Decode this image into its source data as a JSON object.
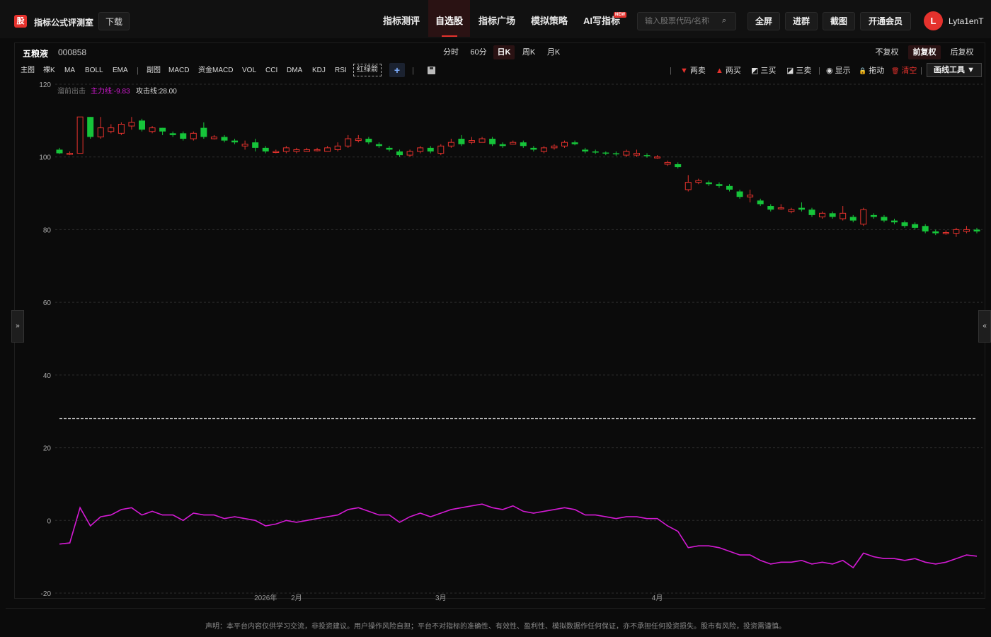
{
  "brand": {
    "logo_char": "股",
    "title": "指标公式评测室",
    "download": "下载"
  },
  "nav": [
    {
      "label": "指标测评",
      "active": false
    },
    {
      "label": "自选股",
      "active": true
    },
    {
      "label": "指标广场",
      "active": false
    },
    {
      "label": "模拟策略",
      "active": false
    },
    {
      "label": "AI写指标",
      "active": false,
      "badge": "NEW"
    }
  ],
  "search": {
    "placeholder": "输入股票代码/名称",
    "icon": "search-icon"
  },
  "top_buttons": [
    "全屏",
    "进群",
    "截图",
    "开通会员"
  ],
  "user": {
    "initial": "L",
    "name": "Lyta1enT"
  },
  "stock": {
    "name": "五粮液",
    "code": "000858"
  },
  "periods": [
    {
      "label": "分时",
      "active": false
    },
    {
      "label": "60分",
      "active": false
    },
    {
      "label": "日K",
      "active": true
    },
    {
      "label": "周K",
      "active": false
    },
    {
      "label": "月K",
      "active": false
    }
  ],
  "rights": [
    {
      "label": "不复权",
      "active": false
    },
    {
      "label": "前复权",
      "active": true
    },
    {
      "label": "后复权",
      "active": false
    }
  ],
  "indicators_main": [
    "主图",
    "裸K",
    "MA",
    "BOLL",
    "EMA"
  ],
  "indicators_sub": [
    "副图",
    "MACD",
    "资金MACD",
    "VOL",
    "CCI",
    "DMA",
    "KDJ",
    "RSI"
  ],
  "redline_label": "红绿箭",
  "plus_label": "+",
  "draw_buttons": [
    {
      "icon": "▼",
      "label": "两卖",
      "color": "#e5322d"
    },
    {
      "icon": "▲",
      "label": "两买",
      "color": "#e5322d"
    },
    {
      "icon": "◩",
      "label": "三买",
      "color": "#dddddd"
    },
    {
      "icon": "◪",
      "label": "三卖",
      "color": "#dddddd"
    },
    {
      "icon": "◉",
      "label": "显示",
      "color": "#dddddd"
    },
    {
      "icon": "🔒",
      "label": "拖动",
      "color": "#dddddd"
    },
    {
      "icon": "🗑",
      "label": "清空",
      "color": "#e5322d"
    }
  ],
  "draw_tool": "画线工具 ▼",
  "side_left": "»",
  "side_right": "«",
  "legend": [
    {
      "label": "溜前出击",
      "color": "#777777"
    },
    {
      "label": "主力线:-9.83",
      "color": "#d41ad4"
    },
    {
      "label": "攻击线:28.00",
      "color": "#dddddd"
    }
  ],
  "disclaimer": "声明：本平台内容仅供学习交流，非投资建议。用户操作风险自担；平台不对指标的准确性、有效性、盈利性、模拟数据作任何保证，亦不承担任何投资损失。股市有风险，投资需谨慎。",
  "chart_data": {
    "type": "candlestick",
    "y_ticks": [
      120,
      100,
      80,
      60,
      40,
      20,
      0,
      -20
    ],
    "ylim": [
      -20,
      120
    ],
    "x_labels": [
      "2026年",
      "2月",
      "3月",
      "4月"
    ],
    "x_label_at": [
      20,
      23,
      37,
      58
    ],
    "attack_line": 28,
    "colors": {
      "up": "#e5322d",
      "down": "#16c43a",
      "main_line": "#d41ad4"
    },
    "candles": [
      [
        102,
        101,
        102.5,
        100.8
      ],
      [
        101,
        101,
        101.5,
        100.5
      ],
      [
        101,
        111,
        111,
        101
      ],
      [
        111,
        105.5,
        111,
        105
      ],
      [
        105.5,
        108,
        111,
        105
      ],
      [
        107,
        108,
        109,
        106.5
      ],
      [
        106.5,
        109,
        109.5,
        106
      ],
      [
        108.5,
        109.5,
        111,
        107.5
      ],
      [
        110,
        107.5,
        110.5,
        107
      ],
      [
        107,
        108,
        108.5,
        106.5
      ],
      [
        108,
        107,
        108,
        106
      ],
      [
        106.5,
        106,
        107,
        105.5
      ],
      [
        106.5,
        105,
        107,
        104.5
      ],
      [
        105,
        106.5,
        107,
        104.5
      ],
      [
        108,
        105.5,
        109.5,
        105
      ],
      [
        105,
        105.5,
        106,
        104.8
      ],
      [
        105.5,
        104.5,
        106,
        104
      ],
      [
        104.5,
        104,
        105,
        103.5
      ],
      [
        103,
        103.5,
        104.5,
        102
      ],
      [
        104,
        102.5,
        105,
        101.5
      ],
      [
        102.5,
        101.5,
        103,
        101
      ],
      [
        101.5,
        101.5,
        102,
        101
      ],
      [
        101.5,
        102.5,
        103,
        101
      ],
      [
        101.5,
        102,
        102.5,
        101
      ],
      [
        101.5,
        102,
        102.5,
        101.5
      ],
      [
        102,
        102,
        102.5,
        101.5
      ],
      [
        101.5,
        102.5,
        103,
        101.5
      ],
      [
        102,
        103,
        104,
        101.5
      ],
      [
        103,
        105,
        106,
        102.5
      ],
      [
        104.5,
        105,
        106,
        104
      ],
      [
        105,
        104,
        105.5,
        103.5
      ],
      [
        103.5,
        103,
        104,
        102.5
      ],
      [
        102.5,
        102,
        103,
        101.5
      ],
      [
        101.5,
        100.5,
        102,
        100
      ],
      [
        100.5,
        101.5,
        102,
        100
      ],
      [
        101.5,
        102.5,
        103,
        101
      ],
      [
        102.5,
        101.5,
        103,
        101
      ],
      [
        101,
        103,
        103.5,
        100.5
      ],
      [
        103,
        104,
        105,
        102.5
      ],
      [
        105,
        103.5,
        106,
        103
      ],
      [
        104,
        104.5,
        105.5,
        103.5
      ],
      [
        104,
        105,
        105.5,
        104
      ],
      [
        105,
        103.5,
        105.5,
        103
      ],
      [
        103.5,
        103,
        104,
        102.5
      ],
      [
        103.5,
        104,
        104.5,
        103.5
      ],
      [
        104,
        103,
        104.5,
        102.5
      ],
      [
        102.5,
        102,
        103,
        101.5
      ],
      [
        101.5,
        102.5,
        103,
        101
      ],
      [
        102.5,
        103,
        103.5,
        102
      ],
      [
        103,
        104,
        104.5,
        102.5
      ],
      [
        104,
        103.5,
        104.5,
        103.2
      ],
      [
        102,
        101.5,
        102.5,
        101
      ],
      [
        101.5,
        101.2,
        102,
        100.8
      ],
      [
        101.2,
        101,
        101.5,
        100.5
      ],
      [
        101,
        100.8,
        101.5,
        100.3
      ],
      [
        100.5,
        101.5,
        102,
        100
      ],
      [
        100.5,
        101,
        102,
        100
      ],
      [
        100.5,
        100.2,
        101,
        99.8
      ],
      [
        100,
        100,
        100.5,
        99.5
      ],
      [
        98,
        98.5,
        99,
        97.5
      ],
      [
        98,
        97.2,
        98.5,
        96.8
      ],
      [
        91,
        93,
        95,
        90.5
      ],
      [
        93,
        93.5,
        94,
        92.5
      ],
      [
        93,
        92.5,
        93.5,
        92
      ],
      [
        92.5,
        92,
        93,
        91.5
      ],
      [
        92,
        91,
        92.5,
        90.5
      ],
      [
        90.5,
        89,
        91,
        88.5
      ],
      [
        89,
        89.5,
        91,
        87.5
      ],
      [
        88,
        87,
        88.5,
        86.5
      ],
      [
        86.5,
        85.5,
        87,
        85
      ],
      [
        86,
        86,
        87,
        85.5
      ],
      [
        85,
        85.5,
        86,
        84.5
      ],
      [
        86,
        85.5,
        87.5,
        85
      ],
      [
        85.5,
        84,
        86,
        83.5
      ],
      [
        83.5,
        84.5,
        85,
        83
      ],
      [
        84.5,
        83.5,
        85,
        83
      ],
      [
        83,
        84.5,
        86.5,
        82.5
      ],
      [
        83.5,
        82.5,
        84,
        82
      ],
      [
        81.5,
        85.5,
        86,
        81
      ],
      [
        84,
        83.5,
        84.5,
        83
      ],
      [
        83.5,
        82.5,
        84,
        82
      ],
      [
        82.5,
        82,
        83,
        81.5
      ],
      [
        82,
        81,
        82.5,
        80.5
      ],
      [
        81.5,
        80.5,
        82,
        80
      ],
      [
        81,
        79.5,
        81.5,
        79
      ],
      [
        79.5,
        79,
        80,
        78.5
      ],
      [
        79,
        79.2,
        79.8,
        78.6
      ],
      [
        79,
        80,
        80.5,
        78
      ],
      [
        79.5,
        80,
        81,
        79
      ],
      [
        80,
        79.5,
        80.5,
        79
      ]
    ],
    "main_line": [
      -6.5,
      -6.2,
      3.5,
      -1.5,
      1,
      1.5,
      3,
      3.5,
      1.5,
      2.5,
      1.5,
      1.5,
      0,
      2,
      1.5,
      1.5,
      0.5,
      1,
      0.5,
      0,
      -1.5,
      -1,
      0,
      -0.5,
      0,
      0.5,
      1,
      1.5,
      3,
      3.5,
      2.5,
      1.5,
      1.5,
      -0.5,
      1,
      2,
      1,
      2,
      3,
      3.5,
      4,
      4.5,
      3.5,
      3,
      4,
      2.5,
      2,
      2.5,
      3,
      3.5,
      3,
      1.5,
      1.5,
      1,
      0.5,
      1,
      1,
      0.5,
      0.5,
      -1.5,
      -3,
      -7.5,
      -7,
      -7,
      -7.5,
      -8.5,
      -9.5,
      -9.5,
      -11,
      -12,
      -11.5,
      -11.5,
      -11,
      -12,
      -11.5,
      -12,
      -11,
      -13,
      -9,
      -10,
      -10.5,
      -10.5,
      -11,
      -10.5,
      -11.5,
      -12,
      -11.5,
      -10.5,
      -9.5,
      -9.83
    ]
  }
}
